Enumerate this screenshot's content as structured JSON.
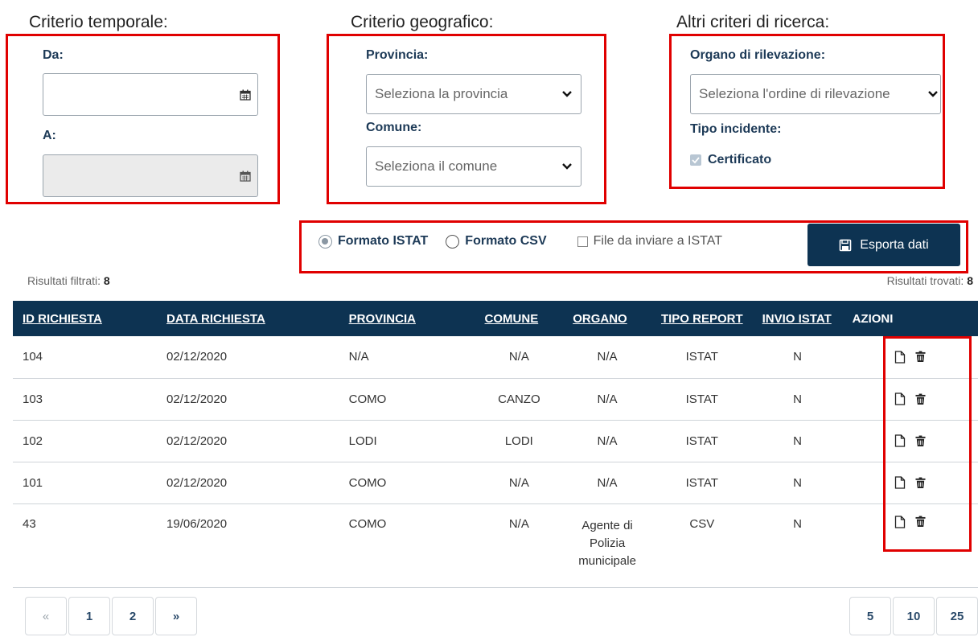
{
  "filters": {
    "temporal": {
      "title": "Criterio temporale:",
      "from_label": "Da:",
      "to_label": "A:",
      "from_value": "",
      "to_value": ""
    },
    "geographic": {
      "title": "Criterio geografico:",
      "province_label": "Provincia:",
      "province_placeholder": "Seleziona la provincia",
      "municipality_label": "Comune:",
      "municipality_placeholder": "Seleziona il comune"
    },
    "other": {
      "title": "Altri criteri di ricerca:",
      "organ_label": "Organo di rilevazione:",
      "organ_placeholder": "Seleziona l'ordine di rilevazione",
      "incident_label": "Tipo incidente:",
      "certified_label": "Certificato",
      "certified_checked": true
    }
  },
  "export": {
    "format_istat": "Formato ISTAT",
    "format_csv": "Formato CSV",
    "selected_format": "ISTAT",
    "send_istat_label": "File da inviare a ISTAT",
    "send_istat_checked": false,
    "button_label": "Esporta dati"
  },
  "counters": {
    "filtered_label": "Risultati filtrati:",
    "filtered_count": "8",
    "found_label": "Risultati trovati:",
    "found_count": "8"
  },
  "table": {
    "headers": [
      "ID RICHIESTA",
      "DATA RICHIESTA",
      "PROVINCIA",
      "COMUNE",
      "ORGANO",
      "TIPO REPORT",
      "INVIO ISTAT",
      "AZIONI"
    ],
    "rows": [
      {
        "id": "104",
        "date": "02/12/2020",
        "province": "N/A",
        "municipality": "N/A",
        "organ": "N/A",
        "report": "ISTAT",
        "istat": "N"
      },
      {
        "id": "103",
        "date": "02/12/2020",
        "province": "COMO",
        "municipality": "CANZO",
        "organ": "N/A",
        "report": "ISTAT",
        "istat": "N"
      },
      {
        "id": "102",
        "date": "02/12/2020",
        "province": "LODI",
        "municipality": "LODI",
        "organ": "N/A",
        "report": "ISTAT",
        "istat": "N"
      },
      {
        "id": "101",
        "date": "02/12/2020",
        "province": "COMO",
        "municipality": "N/A",
        "organ": "N/A",
        "report": "ISTAT",
        "istat": "N"
      },
      {
        "id": "43",
        "date": "19/06/2020",
        "province": "COMO",
        "municipality": "N/A",
        "organ": "Agente di Polizia municipale",
        "report": "CSV",
        "istat": "N"
      }
    ]
  },
  "pagination": {
    "prev": "«",
    "pages": [
      "1",
      "2"
    ],
    "next": "»",
    "page_sizes": [
      "5",
      "10",
      "25"
    ]
  },
  "colors": {
    "header_bg": "#0d3352",
    "highlight": "#e00000"
  }
}
